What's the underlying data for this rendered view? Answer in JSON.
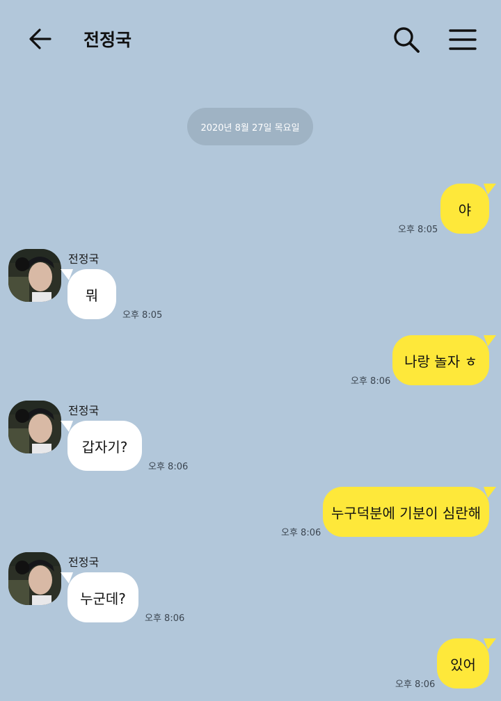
{
  "header": {
    "back_icon": "arrow-left-icon",
    "title": "전정국",
    "search_icon": "search-icon",
    "menu_icon": "hamburger-menu-icon"
  },
  "date_divider": "2020년 8월 27일 목요일",
  "colors": {
    "background": "#b2c7da",
    "my_bubble": "#fee83a",
    "their_bubble": "#ffffff",
    "date_pill": "#9fb3c4"
  },
  "messages": [
    {
      "sender": "me",
      "text": "야",
      "time": "오후 8:05"
    },
    {
      "sender": "them",
      "name": "전정국",
      "text": "뭐",
      "time": "오후 8:05"
    },
    {
      "sender": "me",
      "text": "나랑 놀자 ㅎ",
      "time": "오후 8:06"
    },
    {
      "sender": "them",
      "name": "전정국",
      "text": "갑자기?",
      "time": "오후 8:06"
    },
    {
      "sender": "me",
      "text": "누구덕분에 기분이 심란해",
      "time": "오후 8:06"
    },
    {
      "sender": "them",
      "name": "전정국",
      "text": "누군데?",
      "time": "오후 8:06"
    },
    {
      "sender": "me",
      "text": "있어",
      "time": "오후 8:06"
    }
  ]
}
